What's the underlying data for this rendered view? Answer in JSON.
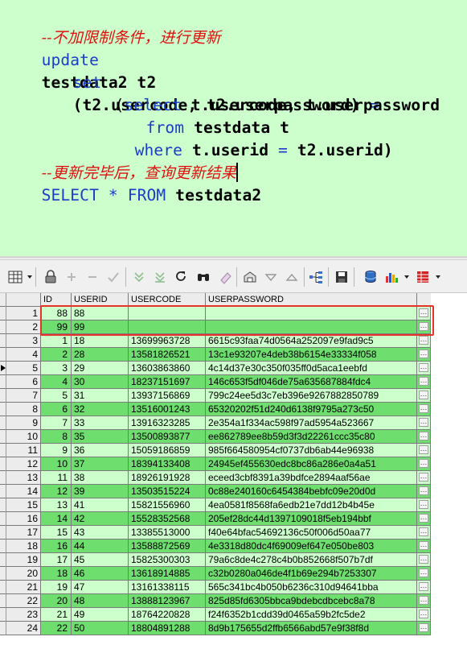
{
  "editor": {
    "comment_top": "--不加限制条件，进行更新",
    "l2_kw": "update",
    "l2_ident": "testdata2 t2",
    "l3_kw": "set",
    "l3_ident": "(t2.usercode, t2.userpassword) ",
    "l3_eq": "=",
    "l4_ident": "(",
    "l4_kw": "select",
    "l4_rest": " t.usercode, t.userpassword",
    "l5_kw": "from",
    "l5_ident": " testdata t",
    "l6_kw": "where",
    "l6_ident": " t.userid ",
    "l6_eq": "=",
    "l6_rest": " t2.userid)",
    "comment_bottom": "--更新完毕后，查询更新结果",
    "l8_kw1": "SELECT",
    "l8_star": " * ",
    "l8_kw2": "FROM",
    "l8_ident": " testdata2"
  },
  "toolbar": {
    "icons": [
      "grid-icon",
      "lock-icon",
      "add-row-icon",
      "delete-row-icon",
      "post-icon",
      "filter-down-icon",
      "filter-icon",
      "refresh-icon",
      "find-icon",
      "clear-icon",
      "import-icon",
      "sort-desc-icon",
      "sort-asc-icon",
      "tree-icon",
      "save-icon",
      "database-icon",
      "chart-icon",
      "table-icon"
    ]
  },
  "grid": {
    "columns": [
      "ID",
      "USERID",
      "USERCODE",
      "USERPASSWORD"
    ],
    "ellipsis": "…",
    "current_row": 5,
    "rows": [
      {
        "n": "1",
        "id": "88",
        "uid": "88",
        "code": "",
        "pwd": ""
      },
      {
        "n": "2",
        "id": "99",
        "uid": "99",
        "code": "",
        "pwd": ""
      },
      {
        "n": "3",
        "id": "1",
        "uid": "18",
        "code": "13699963728",
        "pwd": "6615c93faa74d0564a252097e9fad9c5"
      },
      {
        "n": "4",
        "id": "2",
        "uid": "28",
        "code": "13581826521",
        "pwd": "13c1e93207e4deb38b6154e33334f058"
      },
      {
        "n": "5",
        "id": "3",
        "uid": "29",
        "code": "13603863860",
        "pwd": "4c14d37e30c350f035ff0d5aca1eebfd"
      },
      {
        "n": "6",
        "id": "4",
        "uid": "30",
        "code": "18237151697",
        "pwd": "146c653f5df046de75a635687884fdc4"
      },
      {
        "n": "7",
        "id": "5",
        "uid": "31",
        "code": "13937156869",
        "pwd": "799c24ee5d3c7eb396e9267882850789"
      },
      {
        "n": "8",
        "id": "6",
        "uid": "32",
        "code": "13516001243",
        "pwd": "65320202f51d240d6138f9795a273c50"
      },
      {
        "n": "9",
        "id": "7",
        "uid": "33",
        "code": "13916323285",
        "pwd": "2e354a1f334ac598f97ad5954a523667"
      },
      {
        "n": "10",
        "id": "8",
        "uid": "35",
        "code": "13500893877",
        "pwd": "ee862789ee8b59d3f3d22261ccc35c80"
      },
      {
        "n": "11",
        "id": "9",
        "uid": "36",
        "code": "15059186859",
        "pwd": "985f664580954cf0737db6ab44e96938"
      },
      {
        "n": "12",
        "id": "10",
        "uid": "37",
        "code": "18394133408",
        "pwd": "24945ef455630edc8bc86a286e0a4a51"
      },
      {
        "n": "13",
        "id": "11",
        "uid": "38",
        "code": "18926191928",
        "pwd": "eceed3cbf8391a39bdfce2894aaf56ae"
      },
      {
        "n": "14",
        "id": "12",
        "uid": "39",
        "code": "13503515224",
        "pwd": "0c88e240160c6454384bebfc09e20d0d"
      },
      {
        "n": "15",
        "id": "13",
        "uid": "41",
        "code": "15821556960",
        "pwd": "4ea0581f8568fa6edb21e7dd12b4b45e"
      },
      {
        "n": "16",
        "id": "14",
        "uid": "42",
        "code": "15528352568",
        "pwd": "205ef28dc44d1397109018f5eb194bbf"
      },
      {
        "n": "17",
        "id": "15",
        "uid": "43",
        "code": "13385513000",
        "pwd": "f40e64bfac54692136c50f006d50aa77"
      },
      {
        "n": "18",
        "id": "16",
        "uid": "44",
        "code": "13588872569",
        "pwd": "4e3318d80dc4f69009ef647e050be803"
      },
      {
        "n": "19",
        "id": "17",
        "uid": "45",
        "code": "15825300303",
        "pwd": "79a6c8de4c278c4b0b852668f507b7df"
      },
      {
        "n": "20",
        "id": "18",
        "uid": "46",
        "code": "13618914885",
        "pwd": "c32b0280a046de4f1b69e294b7253307"
      },
      {
        "n": "21",
        "id": "19",
        "uid": "47",
        "code": "13161338115",
        "pwd": "565c341bc4b050b6236c310d94641bba"
      },
      {
        "n": "22",
        "id": "20",
        "uid": "48",
        "code": "13888123967",
        "pwd": "825d85fd6305bbca9bdebcdbcebc8a78"
      },
      {
        "n": "23",
        "id": "21",
        "uid": "49",
        "code": "18764220828",
        "pwd": "f24f6352b1cdd39d0465a59b2fc5de2"
      },
      {
        "n": "24",
        "id": "22",
        "uid": "50",
        "code": "18804891288",
        "pwd": "8d9b175655d2ffb6566abd57e9f38f8d"
      }
    ]
  }
}
